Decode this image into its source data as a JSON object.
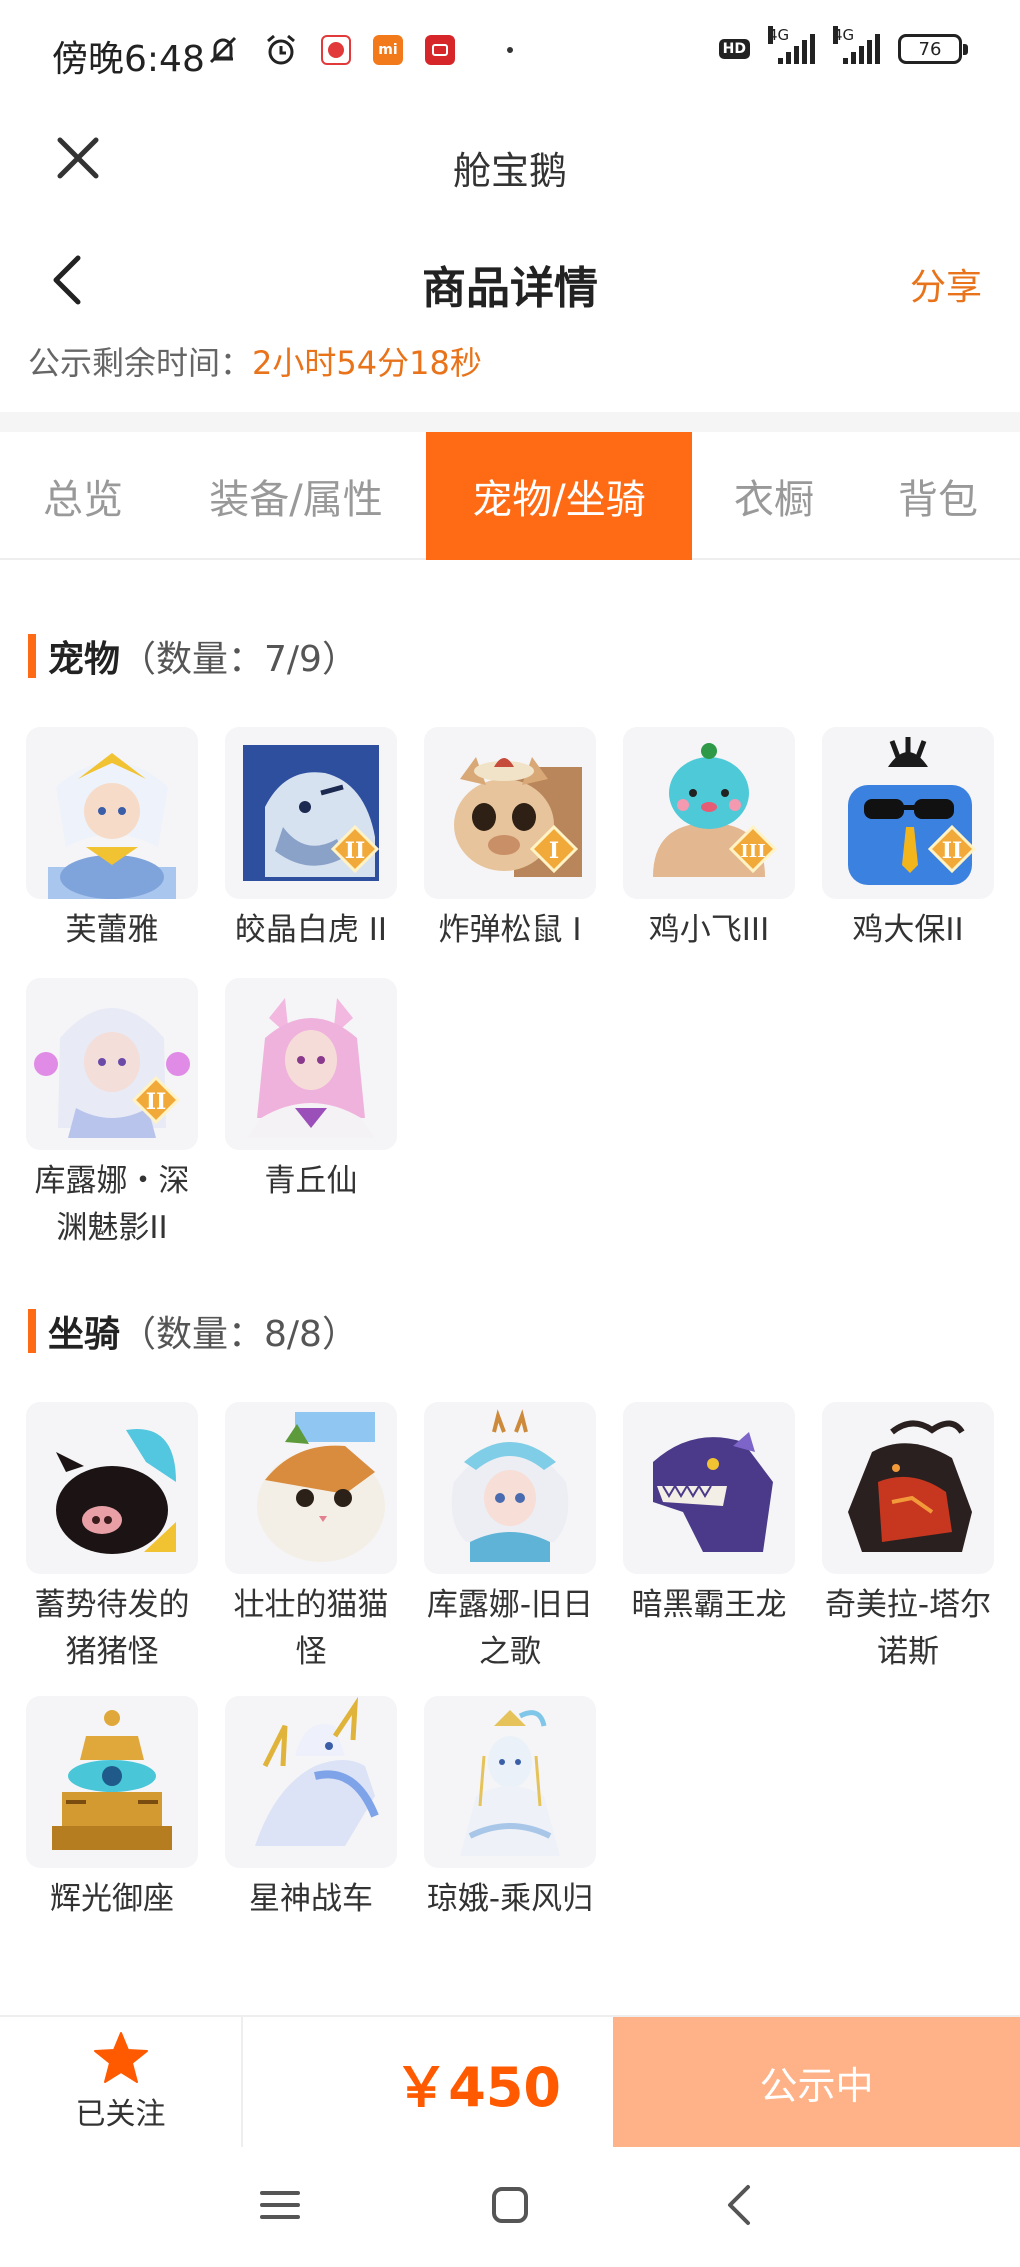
{
  "status_bar": {
    "time": "傍晚6:48",
    "battery": "76",
    "network_1": "4G",
    "network_2": "4G",
    "hd": "HD",
    "app_badge_2": "mi"
  },
  "app": {
    "title": "舱宝鹅"
  },
  "page": {
    "title": "商品详情",
    "share_label": "分享",
    "countdown_label": "公示剩余时间：",
    "countdown_value": "2小时54分18秒"
  },
  "tabs": [
    {
      "label": "总览",
      "active": false
    },
    {
      "label": "装备/属性",
      "active": false
    },
    {
      "label": "宠物/坐骑",
      "active": true
    },
    {
      "label": "衣橱",
      "active": false
    },
    {
      "label": "背包",
      "active": false
    }
  ],
  "pets": {
    "title": "宠物",
    "count": "（数量：7/9）",
    "items": [
      {
        "name": "芙蕾雅",
        "rank": ""
      },
      {
        "name": "皎晶白虎 II",
        "rank": "II"
      },
      {
        "name": "炸弹松鼠 I",
        "rank": "I"
      },
      {
        "name": "鸡小飞III",
        "rank": "III"
      },
      {
        "name": "鸡大保II",
        "rank": "II"
      },
      {
        "name": "库露娜・深渊魅影II",
        "rank": "II"
      },
      {
        "name": "青丘仙",
        "rank": ""
      }
    ]
  },
  "mounts": {
    "title": "坐骑",
    "count": "（数量：8/8）",
    "items": [
      {
        "name": "蓄势待发的猪猪怪"
      },
      {
        "name": "壮壮的猫猫怪"
      },
      {
        "name": "库露娜-旧日之歌"
      },
      {
        "name": "暗黑霸王龙"
      },
      {
        "name": "奇美拉-塔尔诺斯"
      },
      {
        "name": "辉光御座"
      },
      {
        "name": "星神战车"
      },
      {
        "name": "琼娥-乘风归"
      }
    ]
  },
  "bottom_bar": {
    "follow_label": "已关注",
    "price": "￥450",
    "status_button": "公示中"
  },
  "colors": {
    "accent": "#ff6a14",
    "orange_text": "#e8731a",
    "price": "#ff5a00",
    "status_button": "#ffb187"
  }
}
